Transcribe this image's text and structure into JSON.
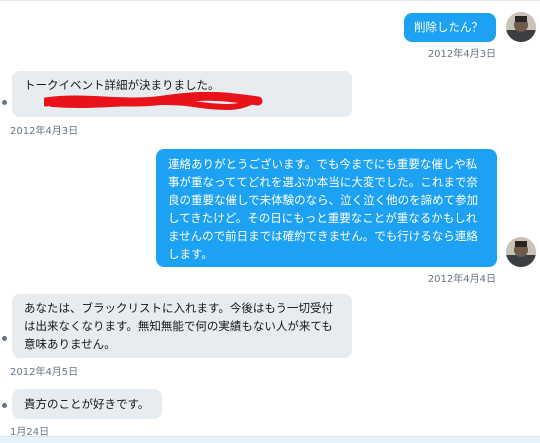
{
  "conversation": {
    "messages": [
      {
        "direction": "sent",
        "text": "削除したん？",
        "timestamp": "2012年4月3日"
      },
      {
        "direction": "received",
        "text": "トークイベント詳細が決まりました。",
        "redacted": true,
        "timestamp": "2012年4月3日"
      },
      {
        "direction": "sent",
        "text": "連絡ありがとうございます。でも今までにも重要な催しや私事が重なっててどれを選ぶか本当に大変でした。これまで奈良の重要な催しで未体験のなら、泣く泣く他のを諦めて参加してきたけど。その日にもっと重要なことが重なるかもしれませんので前日までは確約できません。でも行けるなら連絡します。",
        "timestamp": "2012年4月4日"
      },
      {
        "direction": "received",
        "text": "あなたは、ブラックリストに入れます。今後はもう一切受付は出来なくなります。無知無能で何の実績もない人が来ても意味ありません。",
        "timestamp": "2012年4月5日"
      },
      {
        "direction": "received",
        "text": "貴方のことが好きです。",
        "timestamp": "1月24日"
      }
    ]
  },
  "colors": {
    "sent_bubble": "#1da1f2",
    "received_bubble": "#e6ecf0",
    "timestamp": "#657786",
    "redaction": "#e8131a"
  }
}
